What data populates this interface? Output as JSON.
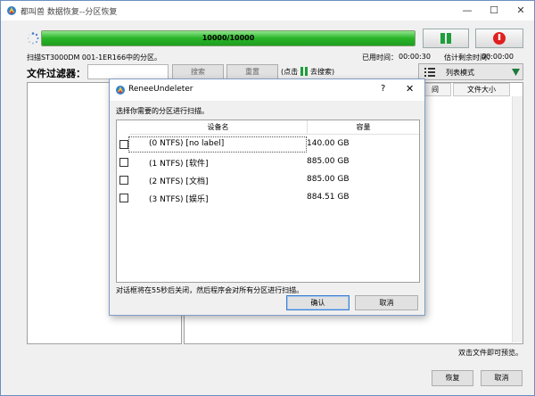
{
  "window": {
    "title": "都叫兽 数据恢复--分区恢复",
    "minimize_symbol": "—",
    "maximize_symbol": "☐",
    "close_symbol": "✕"
  },
  "scan": {
    "progress_fraction": 1.0,
    "progress_label": "10000/10000",
    "status_text": "扫描ST3000DM 001-1ER166中的分区。",
    "elapsed_label": "已用时间：",
    "elapsed_value": "00:00:30",
    "remaining_label": "估计剩余时间：",
    "remaining_value": "00:00:00"
  },
  "filter": {
    "label": "文件过滤器：",
    "input_value": "",
    "search_button": "搜索",
    "reset_button": "重置",
    "hint_prefix": "(点击",
    "hint_suffix": "去搜索)"
  },
  "view_mode": {
    "label": "列表模式"
  },
  "columns": {
    "time": "间",
    "file_size": "文件大小"
  },
  "preview_hint": "双击文件即可预览。",
  "bottom": {
    "recover_button": "恢复",
    "cancel_button": "取消"
  },
  "dialog": {
    "title": "ReneeUndeleter",
    "help_symbol": "?",
    "close_symbol": "✕",
    "prompt": "选择你需要的分区进行扫描。",
    "col_device": "设备名",
    "col_capacity": "容量",
    "partitions": [
      {
        "name": "(0 NTFS) [no label]",
        "capacity": "140.00 GB"
      },
      {
        "name": "(1 NTFS) [软件]",
        "capacity": "885.00 GB"
      },
      {
        "name": "(2 NTFS) [文档]",
        "capacity": "885.00 GB"
      },
      {
        "name": "(3 NTFS) [娱乐]",
        "capacity": "884.51 GB"
      }
    ],
    "note": "对话框将在55秒后关闭，然后程序会对所有分区进行扫描。",
    "ok_button": "确认",
    "cancel_button": "取消"
  },
  "colors": {
    "progress_green": "#28b428",
    "pause_green": "#1e9e3a",
    "stop_red": "#e02020"
  }
}
